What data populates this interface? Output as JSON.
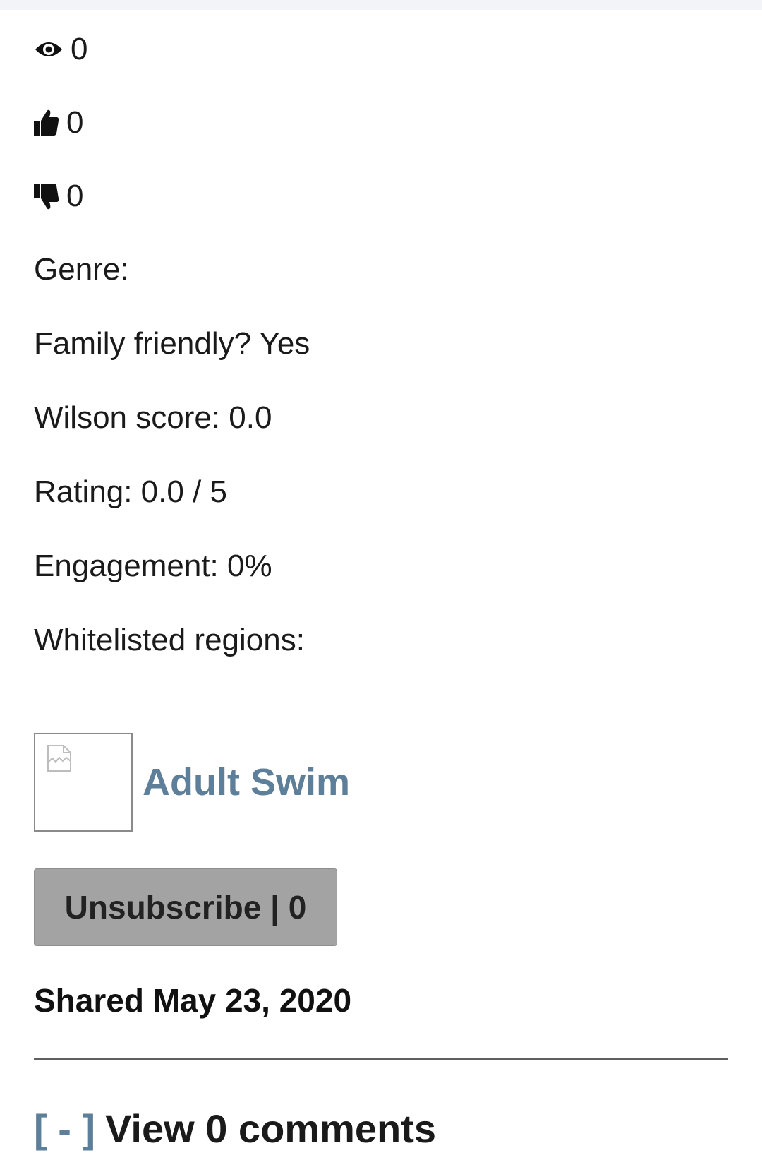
{
  "stats": {
    "views": "0",
    "likes": "0",
    "dislikes": "0"
  },
  "details": {
    "genre": "Genre:",
    "family_friendly": "Family friendly? Yes",
    "wilson_score": "Wilson score: 0.0",
    "rating": "Rating: 0.0 / 5",
    "engagement": "Engagement: 0%",
    "whitelisted_regions": "Whitelisted regions:"
  },
  "channel": {
    "name": "Adult Swim",
    "thumbnail_icon": "broken-image-icon"
  },
  "subscribe_button": {
    "label": "Unsubscribe | 0"
  },
  "shared": "Shared May 23, 2020",
  "comments": {
    "toggle": "[ - ]",
    "label": "View 0 comments"
  },
  "colors": {
    "accent": "#5e7f99",
    "button_bg": "#a3a3a3",
    "divider": "#5f5f5f"
  }
}
